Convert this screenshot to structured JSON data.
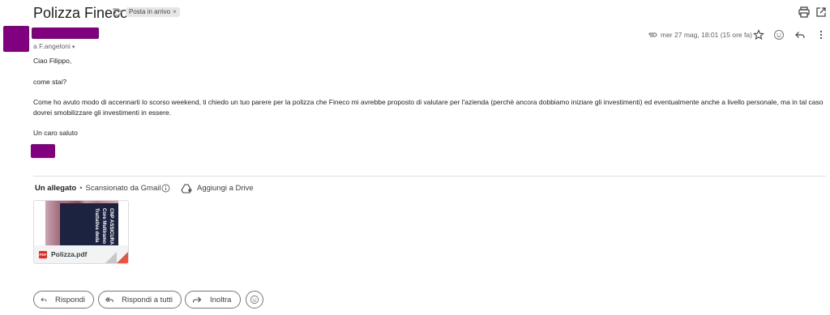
{
  "email": {
    "subject": "Polizza Fineco",
    "label_chip": "Posta in arrivo",
    "label_remove": "×",
    "recipient": "a F.angeloni",
    "recipient_caret": "▾",
    "date": "mer 27 mag, 18:01 (15 ore fa)"
  },
  "body": {
    "greeting": "Ciao Filippo,",
    "question": "come stai?",
    "paragraph_line1": "Come ho avuto modo di accennarti lo scorso weekend, ti chiedo un tuo parere per la polizza che Fineco mi avrebbe proposto di valutare per l'azienda (perchè ancora dobbiamo iniziare gli investimenti) ed eventualmente anche a livello personale, ma in tal caso",
    "paragraph_line2": "dovrei smobilizzare gli investimenti in essere.",
    "closing": "Un caro saluto"
  },
  "attachments": {
    "title": "Un allegato",
    "separator": "•",
    "scan_note": "Scansionato da Gmail",
    "add_to_drive": "Aggiungi a Drive",
    "file": {
      "badge": "PDF",
      "name": "Polizza.pdf",
      "thumbnail_text": [
        "CNP ASSICURA",
        "Core Multiramo",
        "Trattativa deda"
      ]
    }
  },
  "actions": {
    "reply": "Rispondi",
    "reply_all": "Rispondi a tutti",
    "forward": "Inoltra"
  },
  "icons": {
    "importance": "importance-marker-icon",
    "print": "print-icon",
    "open_new_window": "open-in-new-window-icon",
    "attachment": "paperclip-icon",
    "star": "star-icon",
    "emoji": "emoji-reaction-icon",
    "reply": "reply-icon",
    "more": "more-vertical-icon",
    "info": "info-icon",
    "drive": "add-to-drive-icon"
  },
  "colors": {
    "redaction": "#800080",
    "pdf_red": "#d93025"
  }
}
